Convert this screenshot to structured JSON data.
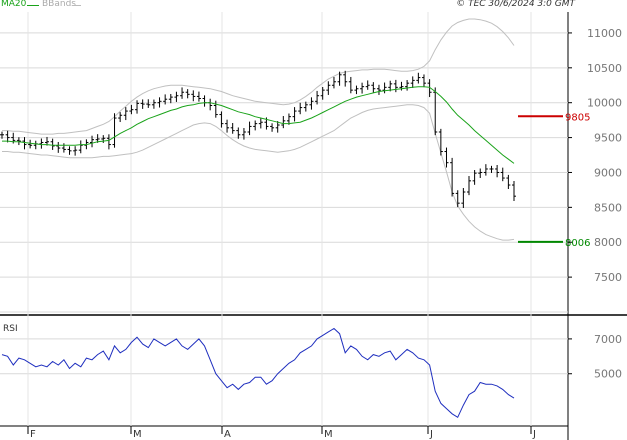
{
  "header": {
    "ma_label": "MA20",
    "bb_label": "BBands",
    "copyright": "© TEC 30/6/2024 3:0 GMT"
  },
  "colors": {
    "ma": "#1aa31a",
    "bands": "#c0c0c0",
    "price": "#000000",
    "rsi": "#1f2fbf",
    "resistance": "#cc0000",
    "support": "#008800",
    "grid": "#d9d9d9"
  },
  "chart_data": [
    {
      "type": "ohlc",
      "name": "price",
      "y_ticks": [
        11000,
        10500,
        10000,
        9500,
        9000,
        8500,
        8000,
        7500
      ],
      "ylim": [
        7000,
        11300
      ],
      "x_ticks": [
        "F",
        "M",
        "A",
        "M",
        "J",
        "J"
      ],
      "levels": [
        {
          "label": "9805",
          "value": 9805,
          "color": "#cc0000"
        },
        {
          "label": "8006",
          "value": 8006,
          "color": "#008800"
        }
      ],
      "close": [
        9540,
        9500,
        9460,
        9450,
        9400,
        9390,
        9410,
        9430,
        9440,
        9380,
        9350,
        9330,
        9310,
        9320,
        9390,
        9430,
        9470,
        9480,
        9490,
        9400,
        9780,
        9820,
        9880,
        9900,
        9990,
        9980,
        9970,
        10000,
        10020,
        10050,
        10080,
        10100,
        10150,
        10120,
        10090,
        10060,
        10000,
        9960,
        9830,
        9700,
        9640,
        9600,
        9540,
        9580,
        9660,
        9700,
        9720,
        9660,
        9640,
        9680,
        9740,
        9800,
        9880,
        9930,
        9970,
        10020,
        10100,
        10180,
        10250,
        10300,
        10400,
        10300,
        10180,
        10200,
        10230,
        10250,
        10200,
        10180,
        10220,
        10270,
        10220,
        10230,
        10280,
        10320,
        10360,
        10280,
        10150,
        9580,
        9300,
        9140,
        8700,
        8560,
        8720,
        8880,
        8990,
        9000,
        9050,
        9050,
        9000,
        8920,
        8820,
        8660
      ],
      "ma20": [
        9450,
        9450,
        9440,
        9440,
        9430,
        9420,
        9410,
        9400,
        9400,
        9390,
        9390,
        9390,
        9390,
        9390,
        9400,
        9400,
        9420,
        9440,
        9450,
        9460,
        9510,
        9560,
        9600,
        9640,
        9690,
        9730,
        9770,
        9800,
        9830,
        9860,
        9890,
        9910,
        9940,
        9960,
        9970,
        9990,
        10000,
        10000,
        9980,
        9960,
        9930,
        9900,
        9870,
        9850,
        9830,
        9800,
        9780,
        9760,
        9740,
        9720,
        9700,
        9700,
        9710,
        9720,
        9750,
        9780,
        9820,
        9860,
        9900,
        9940,
        9980,
        10020,
        10050,
        10080,
        10100,
        10120,
        10140,
        10160,
        10170,
        10180,
        10190,
        10200,
        10210,
        10220,
        10230,
        10230,
        10220,
        10160,
        10090,
        10010,
        9910,
        9820,
        9750,
        9680,
        9600,
        9530,
        9460,
        9390,
        9320,
        9250,
        9190,
        9130
      ],
      "bb_upper": [
        9600,
        9600,
        9590,
        9590,
        9580,
        9570,
        9560,
        9550,
        9550,
        9550,
        9560,
        9560,
        9570,
        9580,
        9590,
        9600,
        9630,
        9660,
        9690,
        9730,
        9800,
        9880,
        9950,
        10020,
        10080,
        10130,
        10170,
        10200,
        10220,
        10240,
        10250,
        10250,
        10250,
        10240,
        10230,
        10220,
        10210,
        10200,
        10180,
        10160,
        10130,
        10100,
        10080,
        10060,
        10040,
        10020,
        10010,
        10000,
        9990,
        9980,
        9970,
        9980,
        10000,
        10040,
        10090,
        10150,
        10220,
        10280,
        10340,
        10380,
        10420,
        10440,
        10450,
        10460,
        10470,
        10470,
        10480,
        10480,
        10480,
        10470,
        10460,
        10450,
        10450,
        10460,
        10480,
        10520,
        10600,
        10760,
        10900,
        11010,
        11100,
        11150,
        11180,
        11200,
        11200,
        11190,
        11170,
        11140,
        11090,
        11020,
        10930,
        10820
      ],
      "bb_lower": [
        9300,
        9300,
        9290,
        9290,
        9280,
        9270,
        9260,
        9250,
        9250,
        9240,
        9230,
        9220,
        9210,
        9210,
        9210,
        9210,
        9210,
        9220,
        9230,
        9230,
        9240,
        9250,
        9260,
        9270,
        9290,
        9320,
        9360,
        9400,
        9440,
        9480,
        9520,
        9560,
        9600,
        9640,
        9680,
        9700,
        9710,
        9700,
        9660,
        9600,
        9530,
        9470,
        9420,
        9380,
        9350,
        9330,
        9320,
        9310,
        9300,
        9290,
        9300,
        9310,
        9330,
        9360,
        9400,
        9440,
        9480,
        9520,
        9560,
        9600,
        9660,
        9720,
        9780,
        9820,
        9860,
        9890,
        9910,
        9920,
        9930,
        9940,
        9950,
        9960,
        9970,
        9970,
        9960,
        9930,
        9850,
        9560,
        9280,
        9010,
        8720,
        8520,
        8400,
        8300,
        8220,
        8160,
        8110,
        8080,
        8050,
        8030,
        8030,
        8040
      ]
    },
    {
      "type": "line",
      "name": "RSI",
      "title": "RSI",
      "y_ticks": [
        70,
        50
      ],
      "ylim": [
        20,
        82
      ],
      "values": [
        61,
        60,
        55,
        59,
        58,
        56,
        54,
        55,
        54,
        57,
        55,
        58,
        53,
        56,
        54,
        59,
        58,
        61,
        63,
        58,
        66,
        62,
        64,
        68,
        71,
        67,
        65,
        70,
        68,
        66,
        68,
        70,
        66,
        64,
        67,
        70,
        66,
        58,
        50,
        46,
        42,
        44,
        41,
        44,
        45,
        48,
        48,
        44,
        46,
        50,
        53,
        56,
        58,
        62,
        64,
        66,
        70,
        72,
        74,
        76,
        73,
        62,
        66,
        64,
        60,
        58,
        61,
        60,
        62,
        63,
        58,
        61,
        64,
        62,
        59,
        58,
        55,
        40,
        33,
        30,
        27,
        25,
        32,
        38,
        40,
        45,
        44,
        44,
        43,
        41,
        38,
        36
      ]
    }
  ]
}
